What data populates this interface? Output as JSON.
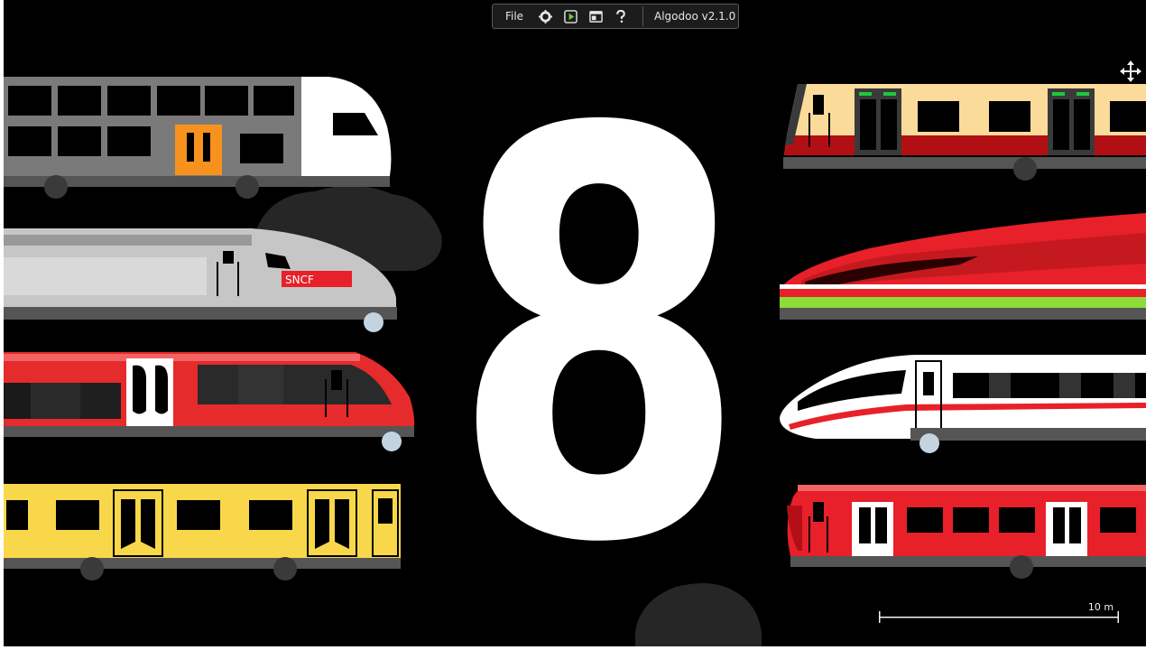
{
  "toolbar": {
    "file_label": "File",
    "version_label": "Algodoo v2.1.0",
    "icons": [
      "gear-icon",
      "play-icon",
      "window-icon",
      "help-icon"
    ]
  },
  "scene": {
    "big_number": "8",
    "sncf_label": "SNCF",
    "scale_label": "10 m"
  },
  "colors": {
    "background": "#000000",
    "accent_red": "#e8202a",
    "accent_yellow": "#f8d84a",
    "accent_orange": "#f7921e",
    "accent_green": "#8edb3a"
  }
}
